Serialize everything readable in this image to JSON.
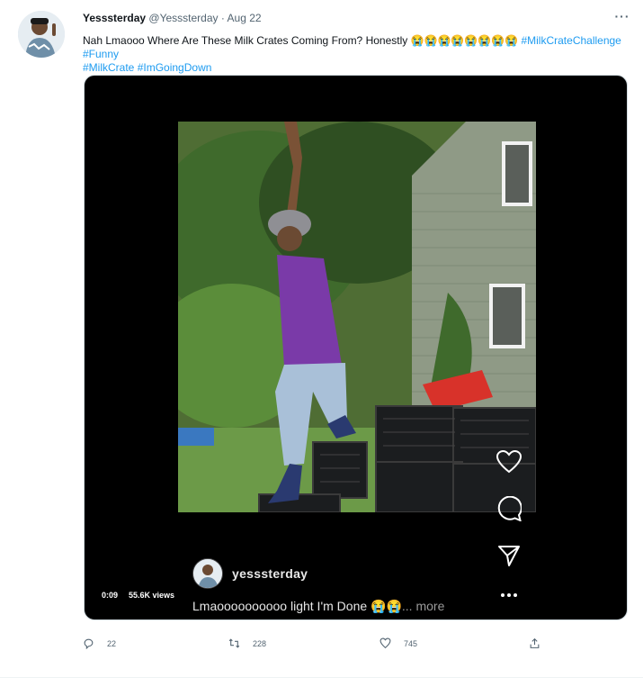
{
  "tweet": {
    "author_name": "Yesssterday",
    "author_handle": "@Yesssterday",
    "separator": "·",
    "date": "Aug 22",
    "more_icon": "more-dots-icon",
    "text_plain": "Nah Lmaooo Where Are These Milk Crates Coming From? Honestly ",
    "emoji": "😭😭😭😭😭😭😭😭",
    "hashtags": [
      "#MilkCrateChallenge",
      "#Funny",
      "#MilkCrate",
      "#ImGoingDown"
    ]
  },
  "media": {
    "views": "55.6K views",
    "duration": "0:09",
    "ig_username": "yesssterday",
    "ig_caption": "Lmaoooooooooo light I'm Done 😭😭",
    "ig_more": "... more",
    "side_icons": [
      "heart-icon",
      "comment-icon",
      "send-icon",
      "ellipsis-icon"
    ]
  },
  "actions": {
    "reply_count": "22",
    "retweet_count": "228",
    "like_count": "745"
  },
  "colors": {
    "link": "#1d9bf0",
    "secondary": "#536471",
    "media_bg": "#000000"
  }
}
